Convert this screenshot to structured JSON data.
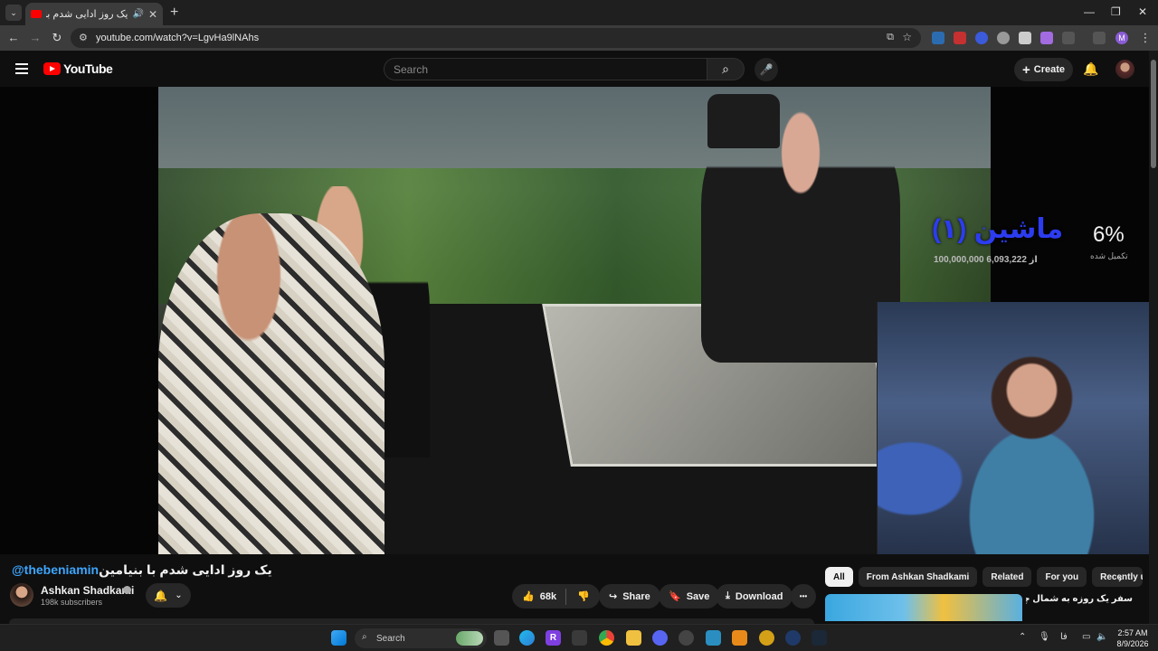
{
  "browser": {
    "tab_title": "یک روز ادایی شدم با بنیامین",
    "tab_close": "✕",
    "new_tab": "+",
    "url": "youtube.com/watch?v=LgvHa9lNAhs",
    "back": "←",
    "forward": "→",
    "reload": "↻",
    "window_controls": {
      "minimize": "—",
      "restore": "❐",
      "close": "✕"
    },
    "profile_initial": "M"
  },
  "youtube": {
    "logo_text": "YouTube",
    "search_placeholder": "Search",
    "create_label": "Create",
    "create_icon": "+"
  },
  "player": {
    "overlay_title": "ماشین (۱)",
    "overlay_subtitle": "100,000,000 از 6,093,222",
    "overlay_percent": "6%",
    "overlay_percent_label": "تکمیل شده"
  },
  "video": {
    "title_handle": "@thebeniamin",
    "title_text": "یک روز ادایی شدم با بنیامین",
    "channel_name": "Ashkan Shadkami",
    "subscribers": "198k subscribers",
    "likes": "68k",
    "share_label": "Share",
    "save_label": "Save",
    "download_label": "Download",
    "more_label": "•••"
  },
  "sidebar": {
    "chips": [
      "All",
      "From Ashkan Shadkami",
      "Related",
      "For you",
      "Recently u"
    ],
    "rec_title": "سفر یک روزه به شمال چهارتایی 😂"
  },
  "taskbar": {
    "search_placeholder": "Search",
    "tray_lang": "فا",
    "time": "2:57 AM",
    "date": "8/9/2026"
  },
  "colors": {
    "youtube_red": "#ff0000",
    "link_blue": "#3ea6ff",
    "overlay_blue": "#2c3cf0",
    "background": "#0f0f0f"
  }
}
